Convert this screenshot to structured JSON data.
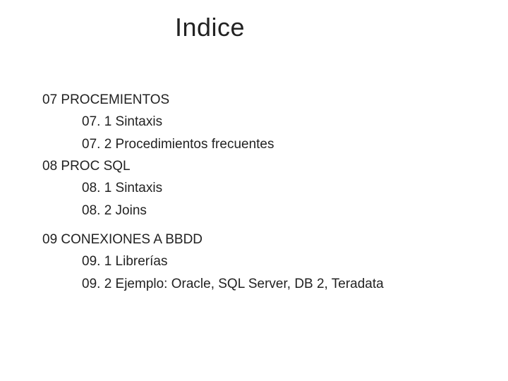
{
  "title": "Indice",
  "sections": [
    {
      "heading": "07 PROCEMIENTOS",
      "items": [
        "07. 1 Sintaxis",
        "07. 2 Procedimientos frecuentes"
      ]
    },
    {
      "heading": "08 PROC SQL",
      "items": [
        "08. 1 Sintaxis",
        "08. 2 Joins"
      ]
    },
    {
      "heading": "09 CONEXIONES A BBDD",
      "items": [
        "09. 1 Librerías",
        "09. 2 Ejemplo: Oracle, SQL Server, DB 2, Teradata"
      ]
    }
  ]
}
